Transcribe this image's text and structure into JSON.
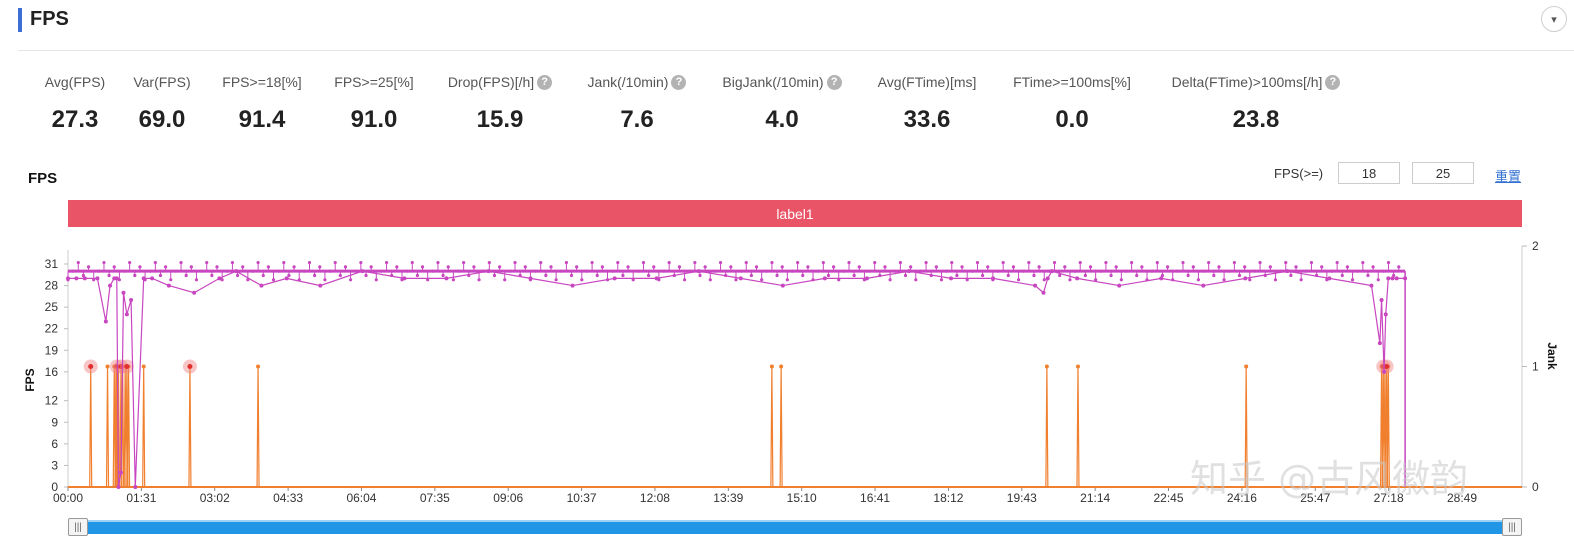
{
  "header": {
    "title": "FPS",
    "collapse_icon": "▾"
  },
  "metrics": [
    {
      "label": "Avg(FPS)",
      "value": "27.3",
      "help": false
    },
    {
      "label": "Var(FPS)",
      "value": "69.0",
      "help": false
    },
    {
      "label": "FPS>=18[%]",
      "value": "91.4",
      "help": false
    },
    {
      "label": "FPS>=25[%]",
      "value": "91.0",
      "help": false
    },
    {
      "label": "Drop(FPS)[/h]",
      "value": "15.9",
      "help": true
    },
    {
      "label": "Jank(/10min)",
      "value": "7.6",
      "help": true
    },
    {
      "label": "BigJank(/10min)",
      "value": "4.0",
      "help": true
    },
    {
      "label": "Avg(FTime)[ms]",
      "value": "33.6",
      "help": false
    },
    {
      "label": "FTime>=100ms[%]",
      "value": "0.0",
      "help": false
    },
    {
      "label": "Delta(FTime)>100ms[/h]",
      "value": "23.8",
      "help": true
    }
  ],
  "chart_panel": {
    "title": "FPS",
    "threshold_label": "FPS(>=)",
    "threshold_1": "18",
    "threshold_2": "25",
    "reset_label": "重置",
    "band_label": "label1"
  },
  "watermark": "知乎 @古风徽韵",
  "colors": {
    "fps_series": "#c846c0",
    "jank_series": "#f07f2e",
    "band": "#ea5467",
    "scroll": "#2196e6",
    "accent": "#3b6fd4"
  },
  "chart_data": {
    "type": "line",
    "title": "",
    "xlabel": "",
    "ylabel": "FPS",
    "y2label": "Jank",
    "x_ticks": [
      "00:00",
      "01:31",
      "03:02",
      "04:33",
      "06:04",
      "07:35",
      "09:06",
      "10:37",
      "12:08",
      "13:39",
      "15:10",
      "16:41",
      "18:12",
      "19:43",
      "21:14",
      "22:45",
      "24:16",
      "25:47",
      "27:18",
      "28:49"
    ],
    "y_ticks": [
      0,
      3,
      6,
      9,
      12,
      16,
      19,
      22,
      25,
      28,
      31
    ],
    "y2_ticks": [
      0,
      1,
      2
    ],
    "xlim": [
      0,
      1729
    ],
    "ylim": [
      0,
      33.5
    ],
    "y2lim": [
      0,
      2
    ],
    "series": [
      {
        "axis": "left",
        "baseline": 30,
        "x": [
          0,
          10,
          20,
          35,
          45,
          50,
          55,
          58,
          60,
          63,
          66,
          70,
          75,
          80,
          90,
          100,
          120,
          150,
          180,
          200,
          230,
          260,
          300,
          350,
          400,
          450,
          500,
          550,
          600,
          650,
          700,
          750,
          800,
          850,
          900,
          950,
          1000,
          1050,
          1100,
          1150,
          1160,
          1165,
          1170,
          1200,
          1250,
          1300,
          1350,
          1400,
          1450,
          1500,
          1550,
          1560,
          1562,
          1565,
          1567,
          1570,
          1575,
          1580,
          1590
        ],
        "y": [
          29,
          29,
          29,
          29,
          23,
          28,
          29,
          29,
          0,
          2,
          27,
          24,
          26,
          0,
          29,
          29,
          28,
          27,
          29,
          30,
          28,
          29,
          28,
          30,
          29,
          29,
          30,
          29,
          28,
          29,
          29,
          30,
          29,
          28,
          29,
          29,
          30,
          29,
          29,
          28,
          27,
          29,
          30,
          29,
          28,
          29,
          28,
          29,
          30,
          29,
          28,
          20,
          26,
          16,
          24,
          29,
          29,
          29,
          29
        ]
      },
      {
        "axis": "right",
        "x": [
          27,
          47,
          55,
          57,
          58,
          60,
          63,
          65,
          68,
          70,
          72,
          90,
          145,
          226,
          837,
          848,
          1164,
          1201,
          1401,
          1562,
          1564,
          1566,
          1568,
          1570
        ],
        "y": [
          1,
          1,
          1,
          1,
          1,
          1,
          1,
          1,
          1,
          1,
          1,
          1,
          1,
          1,
          1,
          1,
          1,
          1,
          1,
          1,
          1,
          1,
          1,
          1
        ]
      }
    ],
    "jank_highlights_x": [
      27,
      58,
      63,
      70,
      145,
      1564,
      1568
    ],
    "grid": false,
    "legend": "none"
  }
}
